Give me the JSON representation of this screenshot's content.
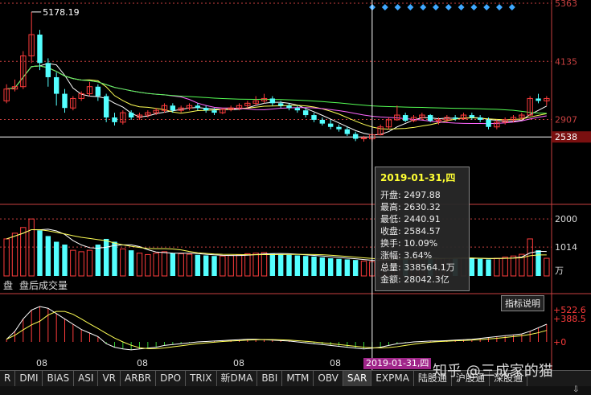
{
  "chart_data": {
    "type": "candlestick",
    "price_axis": {
      "min": 2100,
      "max": 5363,
      "ticks": [
        5363,
        4135,
        2907,
        2538
      ]
    },
    "max_label": "5178.19",
    "volume_axis": {
      "max": 2400,
      "ticks": [
        2000,
        1014
      ],
      "unit": "万"
    },
    "indicator_axis": {
      "ticks": [
        "+522.6",
        "+388.5",
        "+0"
      ]
    },
    "x_labels": [
      "08",
      "08",
      "08",
      "08"
    ],
    "candles": [
      [
        3300,
        3650,
        3250,
        3550
      ],
      [
        3550,
        3750,
        3500,
        3600
      ],
      [
        3600,
        4350,
        3550,
        4250
      ],
      [
        4250,
        5178,
        4100,
        4700
      ],
      [
        4700,
        4800,
        3950,
        4100
      ],
      [
        4100,
        4200,
        3600,
        3800
      ],
      [
        3800,
        3900,
        3200,
        3450
      ],
      [
        3450,
        3550,
        3050,
        3150
      ],
      [
        3150,
        3400,
        3100,
        3350
      ],
      [
        3350,
        3500,
        3300,
        3450
      ],
      [
        3450,
        3700,
        3400,
        3600
      ],
      [
        3600,
        3650,
        3300,
        3400
      ],
      [
        3400,
        3450,
        2850,
        2950
      ],
      [
        2950,
        3050,
        2780,
        2850
      ],
      [
        2850,
        3100,
        2800,
        3050
      ],
      [
        3050,
        3100,
        2900,
        2950
      ],
      [
        2950,
        3050,
        2900,
        3000
      ],
      [
        3000,
        3100,
        2950,
        3050
      ],
      [
        3050,
        3150,
        3000,
        3100
      ],
      [
        3100,
        3250,
        3050,
        3200
      ],
      [
        3200,
        3250,
        3050,
        3100
      ],
      [
        3100,
        3200,
        3050,
        3150
      ],
      [
        3150,
        3250,
        3100,
        3200
      ],
      [
        3200,
        3250,
        3100,
        3150
      ],
      [
        3150,
        3200,
        3050,
        3100
      ],
      [
        3100,
        3150,
        3000,
        3050
      ],
      [
        3050,
        3150,
        3020,
        3120
      ],
      [
        3120,
        3200,
        3080,
        3150
      ],
      [
        3150,
        3250,
        3100,
        3200
      ],
      [
        3200,
        3300,
        3150,
        3250
      ],
      [
        3250,
        3400,
        3200,
        3300
      ],
      [
        3300,
        3450,
        3250,
        3350
      ],
      [
        3350,
        3400,
        3200,
        3250
      ],
      [
        3250,
        3300,
        3150,
        3200
      ],
      [
        3200,
        3250,
        3100,
        3150
      ],
      [
        3150,
        3200,
        3050,
        3100
      ],
      [
        3100,
        3150,
        2950,
        3000
      ],
      [
        3000,
        3050,
        2850,
        2900
      ],
      [
        2900,
        2950,
        2780,
        2820
      ],
      [
        2820,
        2900,
        2700,
        2750
      ],
      [
        2750,
        2800,
        2650,
        2700
      ],
      [
        2700,
        2750,
        2560,
        2600
      ],
      [
        2600,
        2650,
        2450,
        2500
      ],
      [
        2500,
        2560,
        2440,
        2520
      ],
      [
        2497.88,
        2630.32,
        2440.91,
        2584.57
      ],
      [
        2584,
        2800,
        2570,
        2750
      ],
      [
        2750,
        2950,
        2700,
        2900
      ],
      [
        2900,
        3200,
        2880,
        3000
      ],
      [
        3000,
        3050,
        2850,
        2880
      ],
      [
        2880,
        3000,
        2850,
        2950
      ],
      [
        2950,
        3050,
        2900,
        3000
      ],
      [
        3000,
        3020,
        2850,
        2880
      ],
      [
        2880,
        2950,
        2800,
        2900
      ],
      [
        2900,
        3000,
        2850,
        2950
      ],
      [
        2950,
        3000,
        2880,
        2920
      ],
      [
        2920,
        3050,
        2900,
        3000
      ],
      [
        3000,
        3050,
        2900,
        2950
      ],
      [
        2950,
        3000,
        2850,
        2900
      ],
      [
        2900,
        2950,
        2700,
        2750
      ],
      [
        2750,
        2900,
        2700,
        2850
      ],
      [
        2850,
        2950,
        2800,
        2900
      ],
      [
        2900,
        3000,
        2850,
        2950
      ],
      [
        2950,
        3050,
        2900,
        3000
      ],
      [
        3000,
        3400,
        2980,
        3350
      ],
      [
        3350,
        3450,
        3250,
        3300
      ],
      [
        3300,
        3400,
        3200,
        3350
      ]
    ],
    "volumes": [
      1300,
      1500,
      1700,
      2000,
      1600,
      1400,
      1200,
      1100,
      900,
      850,
      900,
      1100,
      1300,
      1200,
      950,
      900,
      800,
      750,
      800,
      850,
      800,
      780,
      760,
      740,
      720,
      700,
      700,
      720,
      740,
      780,
      800,
      820,
      780,
      760,
      740,
      720,
      700,
      680,
      650,
      620,
      600,
      580,
      560,
      520,
      500,
      560,
      620,
      700,
      650,
      620,
      640,
      620,
      600,
      620,
      600,
      640,
      620,
      600,
      580,
      620,
      660,
      700,
      760,
      1300,
      900,
      620
    ],
    "indicator_values": [
      30,
      120,
      260,
      360,
      400,
      380,
      320,
      260,
      200,
      140,
      100,
      60,
      -20,
      -60,
      -80,
      -90,
      -80,
      -70,
      -60,
      -40,
      -30,
      -20,
      -10,
      0,
      5,
      10,
      15,
      20,
      25,
      30,
      30,
      25,
      20,
      15,
      10,
      0,
      -10,
      -20,
      -30,
      -40,
      -50,
      -60,
      -70,
      -80,
      -70,
      -60,
      -40,
      -20,
      -10,
      0,
      5,
      10,
      10,
      15,
      20,
      25,
      30,
      40,
      50,
      60,
      70,
      80,
      90,
      120,
      160,
      200
    ],
    "cursor_index": 44
  },
  "tooltip": {
    "date": "2019-01-31,四",
    "rows": [
      "开盘: 2497.88",
      "最高: 2630.32",
      "最低: 2440.91",
      "收盘: 2584.57",
      "换手: 10.09%",
      "涨幅: 3.64%",
      "总量: 338564.1万",
      "金额: 28042.3亿"
    ]
  },
  "cursor_date": "2019-01-31,四",
  "volume_caption": [
    "盘",
    "盘后成交量"
  ],
  "indicator_button": "指标说明",
  "tabs": [
    "R",
    "DMI",
    "BIAS",
    "ASI",
    "VR",
    "ARBR",
    "DPO",
    "TRIX",
    "新DMA",
    "BBI",
    "MTM",
    "OBV",
    "SAR",
    "EXPMA",
    "陆股通",
    "沪股通",
    "深股通"
  ],
  "watermark": "知乎 @三成家的猫",
  "colors": {
    "up": "#ff3c3c",
    "down": "#54ffff",
    "axis": "#c84040",
    "ma5": "#ffffff",
    "ma10": "#ffff55",
    "ma20": "#ff66ff",
    "ma60": "#55ff55"
  }
}
